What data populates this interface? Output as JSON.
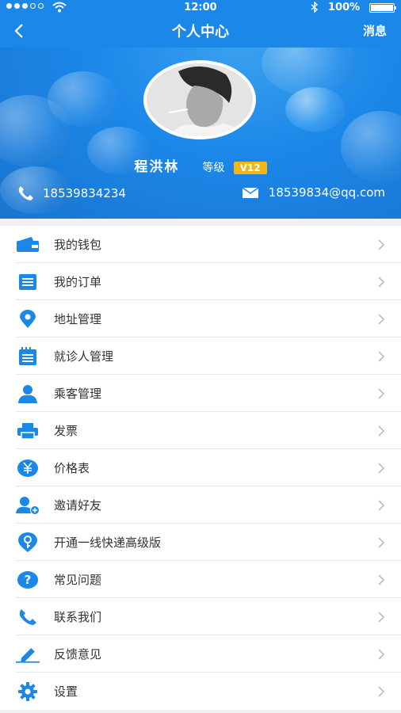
{
  "status_bar": {
    "time": "12:00",
    "battery": "100%"
  },
  "nav": {
    "title": "个人中心",
    "message_label": "消息"
  },
  "profile": {
    "name": "程洪林",
    "level_label": "等级",
    "level_value": "V12",
    "phone": "18539834234",
    "email": "18539834@qq.com"
  },
  "colors": {
    "primary": "#1b87e8",
    "badge": "#f1b617",
    "background": "#f1f1f1"
  },
  "menu": [
    {
      "label": "我的钱包",
      "icon": "wallet-icon"
    },
    {
      "label": "我的订单",
      "icon": "order-list-icon"
    },
    {
      "label": "地址管理",
      "icon": "location-pin-icon"
    },
    {
      "label": "就诊人管理",
      "icon": "notepad-icon"
    },
    {
      "label": "乘客管理",
      "icon": "passenger-icon"
    },
    {
      "label": "发票",
      "icon": "printer-icon"
    },
    {
      "label": "价格表",
      "icon": "yuan-icon"
    },
    {
      "label": "邀请好友",
      "icon": "add-user-icon"
    },
    {
      "label": "开通一线快递高级版",
      "icon": "key-icon"
    },
    {
      "label": "常见问题",
      "icon": "question-icon"
    },
    {
      "label": "联系我们",
      "icon": "phone-icon"
    },
    {
      "label": "反馈意见",
      "icon": "pencil-icon"
    },
    {
      "label": "设置",
      "icon": "gear-icon"
    }
  ]
}
